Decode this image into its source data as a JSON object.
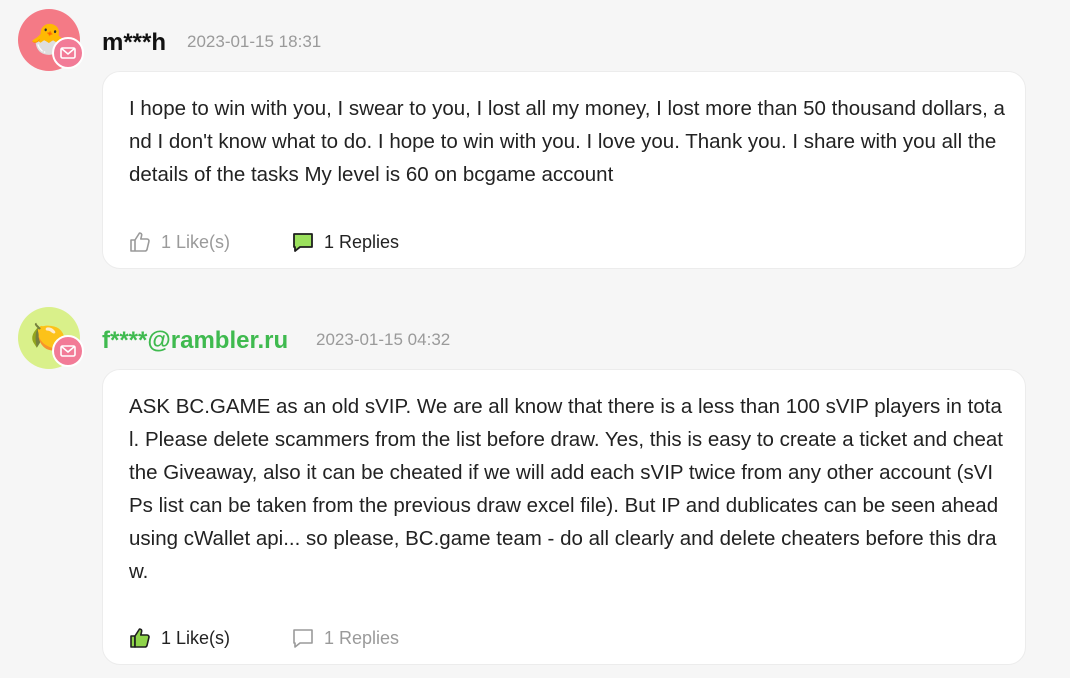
{
  "comments": [
    {
      "avatar_icon": "chick-icon",
      "avatar_bg": "#f47a86",
      "username": "m***h",
      "username_color": "#111111",
      "timestamp": "2023-01-15 18:31",
      "text": "I hope to win with you, I swear to you, I lost all my money, I lost more than 50 thousand dollars, and I don't know what to do. I hope to win with you. I love you. Thank you. I share with you all the details of the tasks My level is 60 on bcgame account",
      "likes_label": "1 Like(s)",
      "likes_active": false,
      "replies_label": "1 Replies",
      "replies_active": true
    },
    {
      "avatar_icon": "lemon-icon",
      "avatar_bg": "#d9f08a",
      "username": "f****@rambler.ru",
      "username_color": "#3fba4f",
      "timestamp": "2023-01-15 04:32",
      "text": "ASK BC.GAME as an old sVIP. We are all know that there is a less than 100 sVIP players in total. Please delete scammers from the list before draw. Yes, this is easy to create a ticket and cheat the Giveaway, also it can be cheated if we will add each sVIP twice from any other account (sVIPs list can be taken from the previous draw excel file). But IP and dublicates can be seen ahead using cWallet api... so please, BC.game team - do all clearly and delete cheaters before this draw.",
      "likes_label": "1 Like(s)",
      "likes_active": true,
      "replies_label": "1 Replies",
      "replies_active": false
    }
  ],
  "colors": {
    "like_active": "#8fd44a",
    "reply_active": "#9be15d",
    "muted": "#9a9a9a",
    "mail_badge": "#f27b97"
  }
}
